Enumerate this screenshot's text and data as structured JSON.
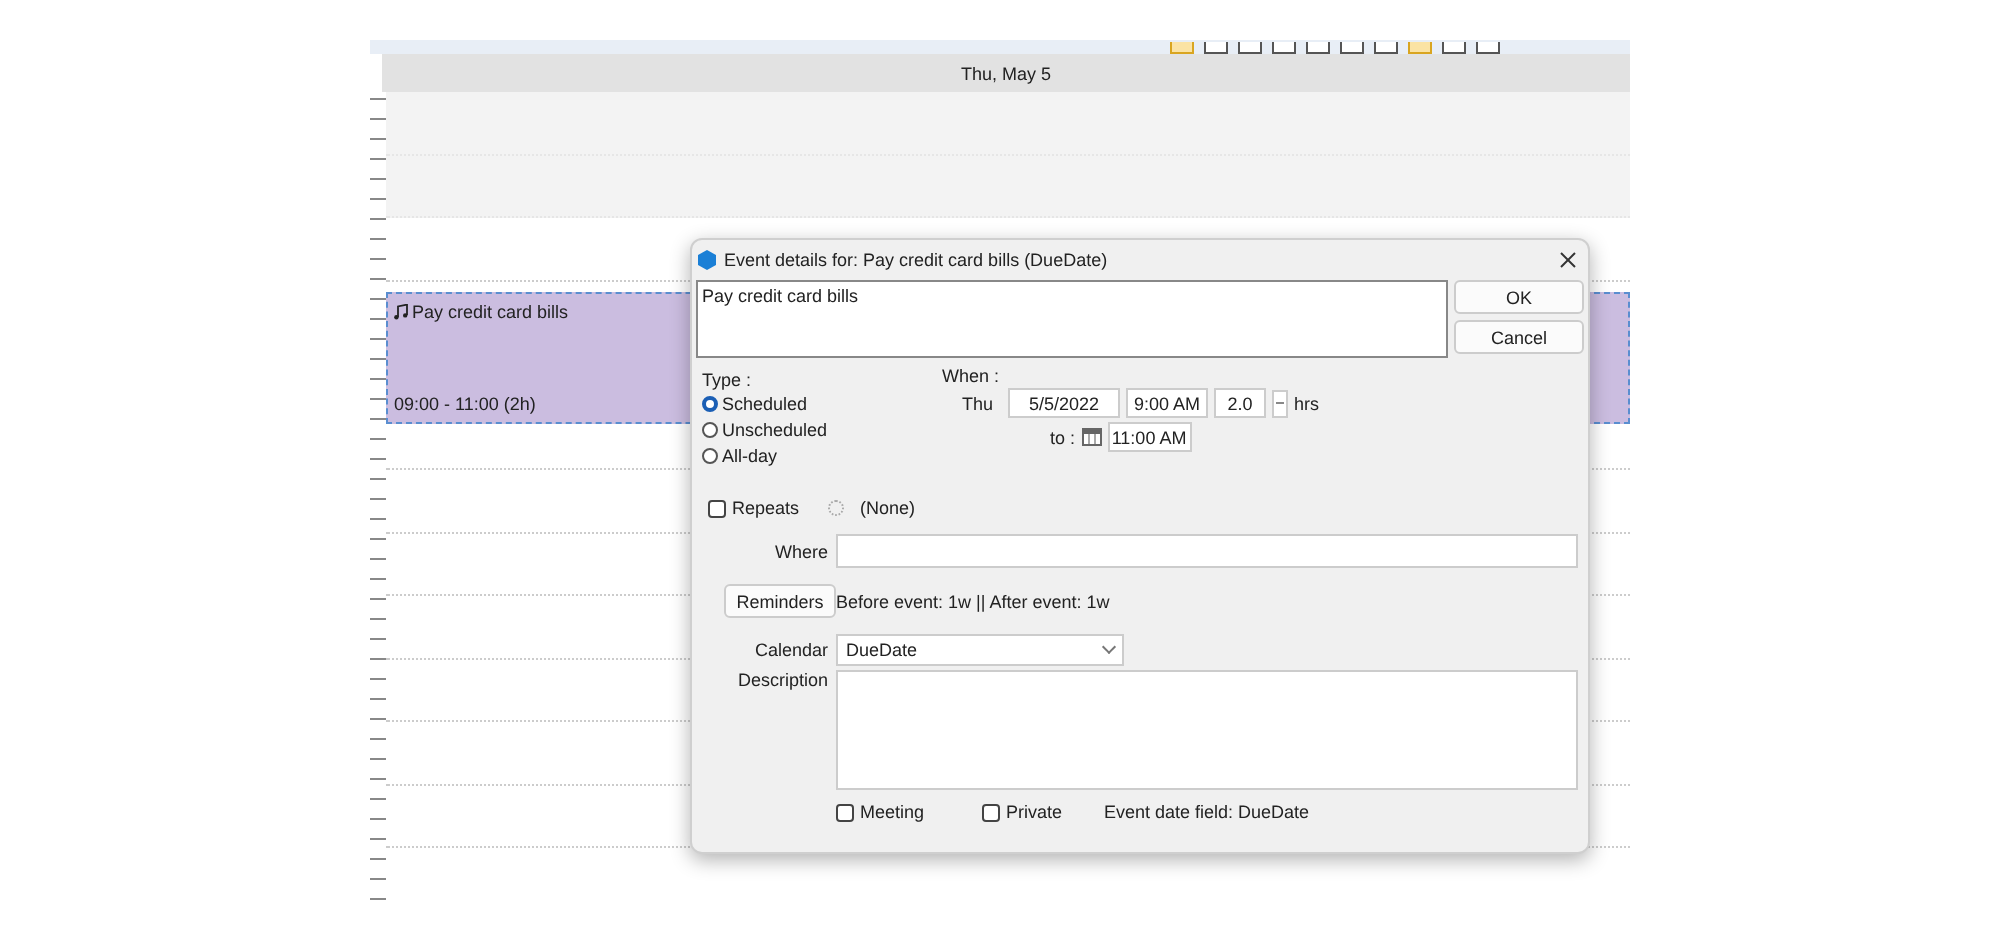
{
  "calendar": {
    "toolbar_buttons": [
      {
        "selected": true
      },
      {
        "selected": false
      },
      {
        "selected": false
      },
      {
        "selected": false
      },
      {
        "selected": false
      },
      {
        "selected": false
      },
      {
        "selected": false
      },
      {
        "selected": true
      },
      {
        "selected": false
      },
      {
        "selected": false
      }
    ],
    "day_header": "Thu, May 5",
    "event": {
      "title": "Pay credit card bills",
      "time": "09:00 - 11:00 (2h)",
      "selected": true
    }
  },
  "dialog": {
    "title": "Event details for: Pay credit card bills (DueDate)",
    "subject": "Pay credit card bills",
    "buttons": [
      "OK",
      "Cancel"
    ],
    "type_label": "Type :",
    "types": [
      {
        "label": "Scheduled",
        "selected": true
      },
      {
        "label": "Unscheduled",
        "selected": false
      },
      {
        "label": "All-day",
        "selected": false
      }
    ],
    "when_label": "When :",
    "day": "Thu",
    "date": "5/5/2022",
    "start_time": "9:00 AM",
    "duration": "2.0",
    "duration_unit": "hrs",
    "to_label": "to :",
    "end_time": "11:00 AM",
    "repeats": {
      "label": "Repeats",
      "checked": false
    },
    "recurrence": "(None)",
    "where_label": "Where",
    "reminders_button": "Reminders",
    "reminders_text": "Before event: 1w || After event: 1w",
    "calendar_label": "Calendar",
    "calendar_value": "DueDate",
    "description_label": "Description",
    "meeting": {
      "label": "Meeting",
      "checked": false
    },
    "private": {
      "label": "Private",
      "checked": false
    },
    "date_field": "Event date field: DueDate"
  }
}
